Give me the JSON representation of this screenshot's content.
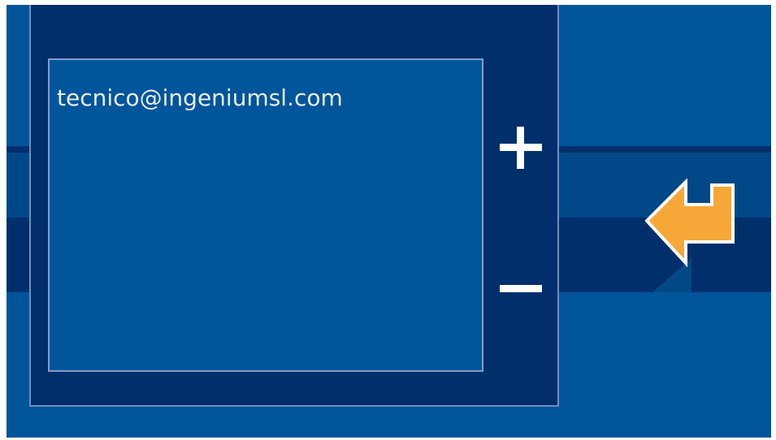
{
  "email_list": {
    "items": [
      "tecnico@ingeniumsl.com"
    ]
  },
  "controls": {
    "add_icon": "plus-icon",
    "remove_icon": "minus-icon",
    "enter_icon": "enter-return-arrow-icon"
  },
  "colors": {
    "background": "#01559b",
    "panel": "#002f6c",
    "band_highlight": "#014889",
    "list_background": "#01559b",
    "list_border": "#7f9ccc",
    "text": "#e8eef8",
    "enter_arrow": "#f7a737"
  }
}
